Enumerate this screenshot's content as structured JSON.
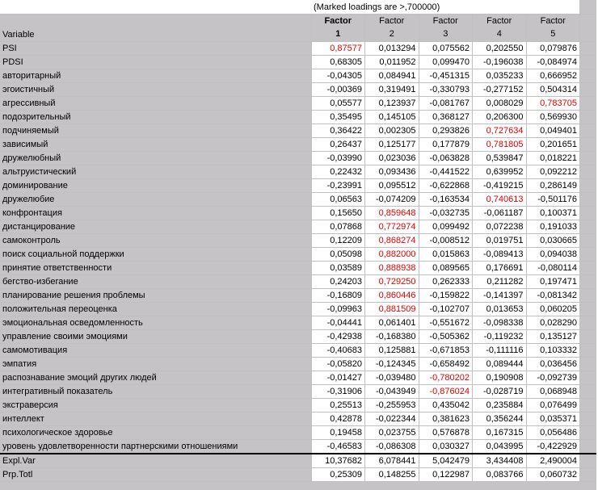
{
  "note": "(Marked loadings are >,700000)",
  "variable_header": "Variable",
  "factors": [
    {
      "name": "Factor",
      "num": "1"
    },
    {
      "name": "Factor",
      "num": "2"
    },
    {
      "name": "Factor",
      "num": "3"
    },
    {
      "name": "Factor",
      "num": "4"
    },
    {
      "name": "Factor",
      "num": "5"
    }
  ],
  "colors": {
    "highlight": "#e00000",
    "header_bg": "#c6c3c6"
  },
  "rows": [
    {
      "label": "PSI",
      "values": [
        "0,87577",
        "0,013294",
        "0,075562",
        "0,202550",
        "0,079876"
      ],
      "hl": [
        0
      ]
    },
    {
      "label": "PDSI",
      "values": [
        "0,68305",
        "0,011952",
        "0,099470",
        "-0,196038",
        "-0,084974"
      ],
      "hl": []
    },
    {
      "label": "авторитарный",
      "values": [
        "-0,04305",
        "0,084941",
        "-0,451315",
        "0,035233",
        "0,666952"
      ],
      "hl": []
    },
    {
      "label": "эгоистичный",
      "values": [
        "-0,00369",
        "0,319491",
        "-0,330793",
        "-0,277152",
        "0,504314"
      ],
      "hl": []
    },
    {
      "label": "агрессивный",
      "values": [
        "0,05577",
        "0,123937",
        "-0,081767",
        "0,008029",
        "0,783705"
      ],
      "hl": [
        4
      ]
    },
    {
      "label": "подозрительный",
      "values": [
        "0,35495",
        "0,145105",
        "0,368127",
        "0,206300",
        "0,569930"
      ],
      "hl": []
    },
    {
      "label": "подчиняемый",
      "values": [
        "0,36422",
        "0,002305",
        "0,293826",
        "0,727634",
        "0,049401"
      ],
      "hl": [
        3
      ]
    },
    {
      "label": "зависимый",
      "values": [
        "0,26437",
        "0,125177",
        "0,177879",
        "0,781805",
        "0,201651"
      ],
      "hl": [
        3
      ]
    },
    {
      "label": "дружелюбный",
      "values": [
        "-0,03990",
        "0,023036",
        "-0,063828",
        "0,539847",
        "0,018221"
      ],
      "hl": []
    },
    {
      "label": "альтруистический",
      "values": [
        "0,22432",
        "0,093436",
        "-0,441522",
        "0,639952",
        "0,092212"
      ],
      "hl": []
    },
    {
      "label": "доминирование",
      "values": [
        "-0,23991",
        "0,095512",
        "-0,622868",
        "-0,419215",
        "0,286149"
      ],
      "hl": []
    },
    {
      "label": "дружелюбие",
      "values": [
        "0,06563",
        "-0,074209",
        "-0,163534",
        "0,740613",
        "-0,501176"
      ],
      "hl": [
        3
      ]
    },
    {
      "label": "конфронтация",
      "values": [
        "0,15650",
        "0,859648",
        "-0,032735",
        "-0,061187",
        "0,100371"
      ],
      "hl": [
        1
      ]
    },
    {
      "label": "дистанцирование",
      "values": [
        "0,07868",
        "0,772974",
        "0,099492",
        "0,072238",
        "0,191033"
      ],
      "hl": [
        1
      ]
    },
    {
      "label": "самоконтроль",
      "values": [
        "0,12209",
        "0,868274",
        "-0,008512",
        "0,019751",
        "0,030665"
      ],
      "hl": [
        1
      ]
    },
    {
      "label": "поиск социальной поддержки",
      "values": [
        "0,05098",
        "0,882000",
        "0,015863",
        "-0,089413",
        "0,094038"
      ],
      "hl": [
        1
      ]
    },
    {
      "label": "принятие ответственности",
      "values": [
        "0,03589",
        "0,888938",
        "0,089565",
        "0,176691",
        "-0,080114"
      ],
      "hl": [
        1
      ]
    },
    {
      "label": "бегство-избегание",
      "values": [
        "0,24203",
        "0,729250",
        "0,262333",
        "0,211282",
        "0,197471"
      ],
      "hl": [
        1
      ]
    },
    {
      "label": "планирование решения проблемы",
      "values": [
        "-0,16809",
        "0,860446",
        "-0,159822",
        "-0,141397",
        "-0,081342"
      ],
      "hl": [
        1
      ]
    },
    {
      "label": "положительная переоценка",
      "values": [
        "-0,09963",
        "0,881509",
        "-0,102707",
        "0,013653",
        "0,060205"
      ],
      "hl": [
        1
      ]
    },
    {
      "label": "эмоциональная осведомленность",
      "values": [
        "-0,04441",
        "0,061401",
        "-0,551672",
        "-0,098338",
        "0,028290"
      ],
      "hl": []
    },
    {
      "label": "управление своими эмоциями",
      "values": [
        "-0,42938",
        "-0,168380",
        "-0,505362",
        "-0,119232",
        "0,135127"
      ],
      "hl": []
    },
    {
      "label": "самомотивация",
      "values": [
        "-0,40683",
        "0,125881",
        "-0,671853",
        "-0,111116",
        "0,103332"
      ],
      "hl": []
    },
    {
      "label": "эмпатия",
      "values": [
        "-0,05820",
        "-0,124345",
        "-0,658492",
        "0,089444",
        "0,036456"
      ],
      "hl": []
    },
    {
      "label": "распознавание эмоций других людей",
      "values": [
        "-0,01427",
        "-0,039480",
        "-0,780202",
        "0,190908",
        "-0,092739"
      ],
      "hl": [
        2
      ]
    },
    {
      "label": "интегративный показатель",
      "values": [
        "-0,31906",
        "-0,043949",
        "-0,876024",
        "-0,028719",
        "0,068948"
      ],
      "hl": [
        2
      ]
    },
    {
      "label": "экстраверсия",
      "values": [
        "0,25513",
        "-0,255953",
        "0,435042",
        "0,235884",
        "0,076499"
      ],
      "hl": []
    },
    {
      "label": "интеллект",
      "values": [
        "0,42878",
        "-0,022344",
        "0,381623",
        "0,356244",
        "0,035371"
      ],
      "hl": []
    },
    {
      "label": "психологическое здоровье",
      "values": [
        "0,19458",
        "0,023755",
        "0,576878",
        "0,167315",
        "0,056486"
      ],
      "hl": []
    },
    {
      "label": "уровень удовлетворенности партнерскими отношениями",
      "values": [
        "-0,46583",
        "-0,086308",
        "0,030327",
        "0,043995",
        "-0,422929"
      ],
      "hl": []
    }
  ],
  "summary": [
    {
      "label": "Expl.Var",
      "values": [
        "10,37682",
        "6,078441",
        "5,042479",
        "3,434408",
        "2,490004"
      ]
    },
    {
      "label": "Prp.Totl",
      "values": [
        "0,25309",
        "0,148255",
        "0,122987",
        "0,083766",
        "0,060732"
      ]
    }
  ]
}
